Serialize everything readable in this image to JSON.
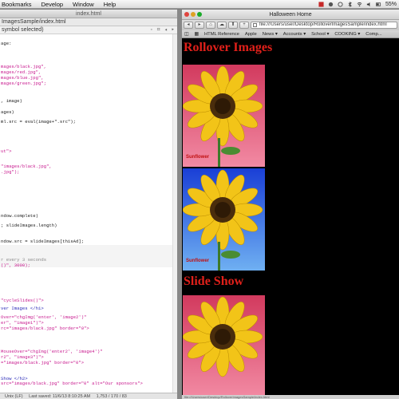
{
  "menubar": {
    "items": [
      "Bookmarks",
      "Develop",
      "Window",
      "Help"
    ],
    "right_status": "55%"
  },
  "editor": {
    "tab_title": "index.html",
    "path": "ImagesSample/index.html",
    "selection": "symbol selected)",
    "code_lines": [
      {
        "text": "age:",
        "cls": "c-k"
      },
      {
        "text": "mages/black.jpg\",",
        "cls": "c-s"
      },
      {
        "text": "mages/red.jpg\",",
        "cls": "c-s"
      },
      {
        "text": "mages/blue.jpg\",",
        "cls": "c-s"
      },
      {
        "text": "mages/green.jpg\";",
        "cls": "c-s"
      },
      {
        "text": ", image)",
        "cls": "c-k"
      },
      {
        "text": "ages)",
        "cls": "c-k"
      },
      {
        "text": "ml.src = eval(image+\".src\");",
        "cls": "c-k"
      },
      {
        "text": "ut\">",
        "cls": "c-s"
      },
      {
        "text": "\"images/black.jpg\",",
        "cls": "c-s"
      },
      {
        "text": ".jpg\");",
        "cls": "c-s"
      },
      {
        "text": "ndow.complete)",
        "cls": "c-k"
      },
      {
        "text": "; slideImages.length)",
        "cls": "c-k"
      },
      {
        "text": "ndow.src = slideImages[thisAd];",
        "cls": "c-k"
      },
      {
        "text": "r every 3 seconds",
        "cls": "c-g"
      },
      {
        "text": "()\", 3000);",
        "cls": "c-s"
      },
      {
        "text": "\"cycleSlides()\">",
        "cls": "c-s"
      },
      {
        "text": "ver Images </h1>",
        "cls": "c-t"
      },
      {
        "text": "Over=\"chgImg('enter', 'image2')\"",
        "cls": "c-s"
      },
      {
        "text": "er\", \"image1\")\">",
        "cls": "c-s"
      },
      {
        "text": "rc=\"images/black.jpg\" border=\"0\">",
        "cls": "c-s"
      },
      {
        "text": "MouseOver=\"chgImg('enter2', 'image4')\"",
        "cls": "c-s"
      },
      {
        "text": "r2\", \"image3\")\">",
        "cls": "c-s"
      },
      {
        "text": "=\"images/black.jpg\" border=\"0\">",
        "cls": "c-s"
      },
      {
        "text": "Show </h2>",
        "cls": "c-t"
      },
      {
        "text": "src=\"images/black.jpg\" border=\"0\" alt=\"Our sponsors\">",
        "cls": "c-s"
      }
    ],
    "status": {
      "encoding": "Unix (LF)",
      "last_saved": "Last saved: 11/6/13 8:10:25 AM",
      "position": "1,753 / 170 / 83"
    }
  },
  "browser": {
    "window_title": "Halloween Home",
    "url": "file:///Users/user/Desktop/RolloverImagesSample/index.html",
    "bookmarks": [
      "HTML Reference",
      "Apple",
      "News ▾",
      "Accounts ▾",
      "School ▾",
      "COOKING ▾",
      "Comp..."
    ],
    "page": {
      "heading_rollover": "Rollover Images",
      "heading_slideshow": "Slide Show",
      "image_caption": "Sunflower"
    },
    "status_text": "file:///Users/user/Desktop/RolloverImagesSample/index.html"
  },
  "colors": {
    "heading_red": "#e0201a",
    "page_bg": "#000000",
    "pink_bg": "#e8577a",
    "blue_bg": "#2a6bd8"
  }
}
